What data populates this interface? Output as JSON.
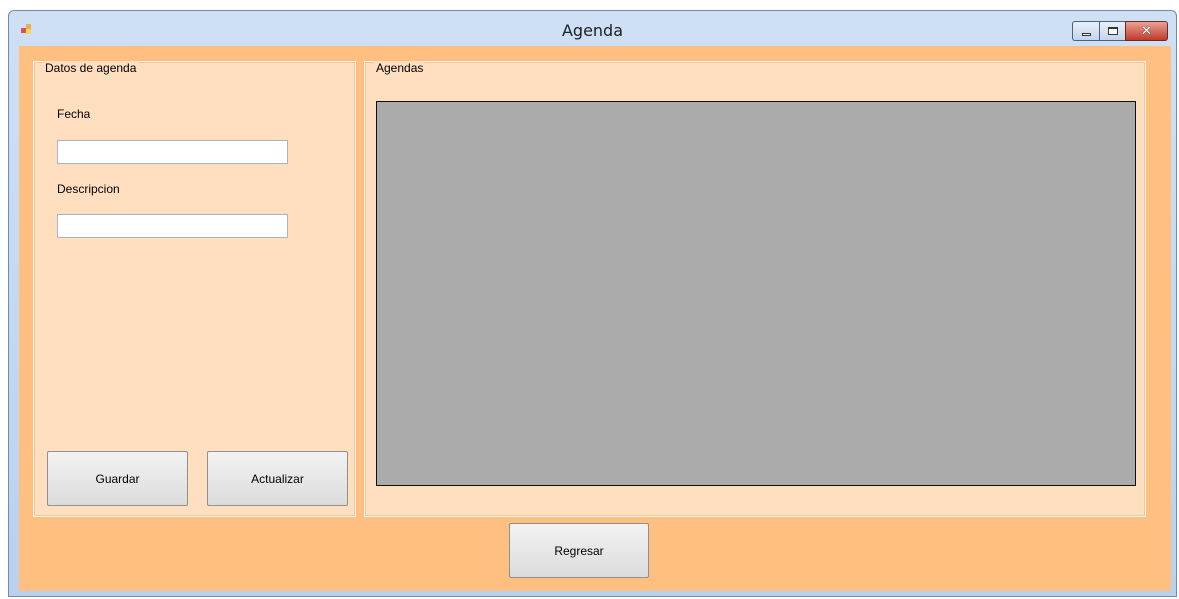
{
  "window": {
    "title": "Agenda",
    "controls": {
      "minimize": "minimize",
      "maximize": "maximize",
      "close": "✕"
    }
  },
  "datos_group": {
    "title": "Datos de agenda",
    "fecha_label": "Fecha",
    "fecha_value": "",
    "descripcion_label": "Descripcion",
    "descripcion_value": "",
    "guardar_label": "Guardar",
    "actualizar_label": "Actualizar"
  },
  "agendas_group": {
    "title": "Agendas"
  },
  "footer": {
    "regresar_label": "Regresar"
  },
  "colors": {
    "form_background": "#ffbf80",
    "groupbox_background": "#ffdfc0",
    "grid_background": "#ababab"
  }
}
